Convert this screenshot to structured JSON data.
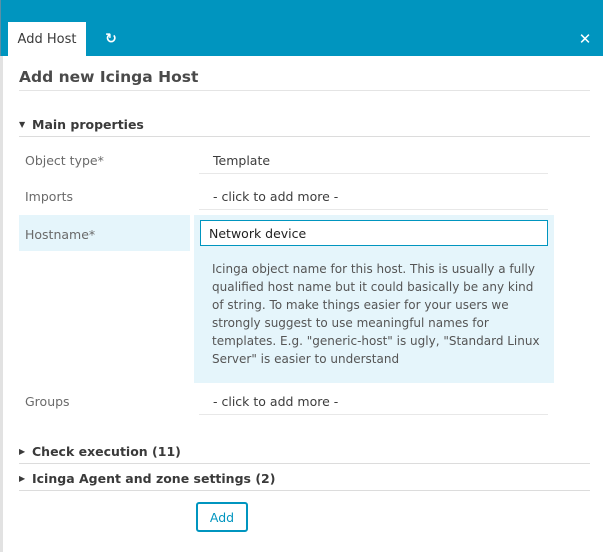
{
  "tabs": {
    "active_label": "Add Host",
    "refresh_icon": "refresh-icon",
    "close_icon": "close-icon"
  },
  "form": {
    "title": "Add new Icinga Host",
    "sections": {
      "main": "Main properties",
      "check": "Check execution (11)",
      "agent": "Icinga Agent and zone settings (2)"
    },
    "fields": {
      "object_type": {
        "label": "Object type*",
        "value": "Template"
      },
      "imports": {
        "label": "Imports",
        "value": "- click to add more -"
      },
      "hostname": {
        "label": "Hostname*",
        "value": "Network device",
        "help": "Icinga object name for this host. This is usually a fully qualified host name but it could basically be any kind of string. To make things easier for your users we strongly suggest to use meaningful names for templates. E.g. \"generic-host\" is ugly, \"Standard Linux Server\" is easier to understand"
      },
      "groups": {
        "label": "Groups",
        "value": "- click to add more -"
      }
    },
    "submit_label": "Add"
  },
  "colors": {
    "accent": "#0095bf",
    "highlight": "#e5f5fb"
  }
}
